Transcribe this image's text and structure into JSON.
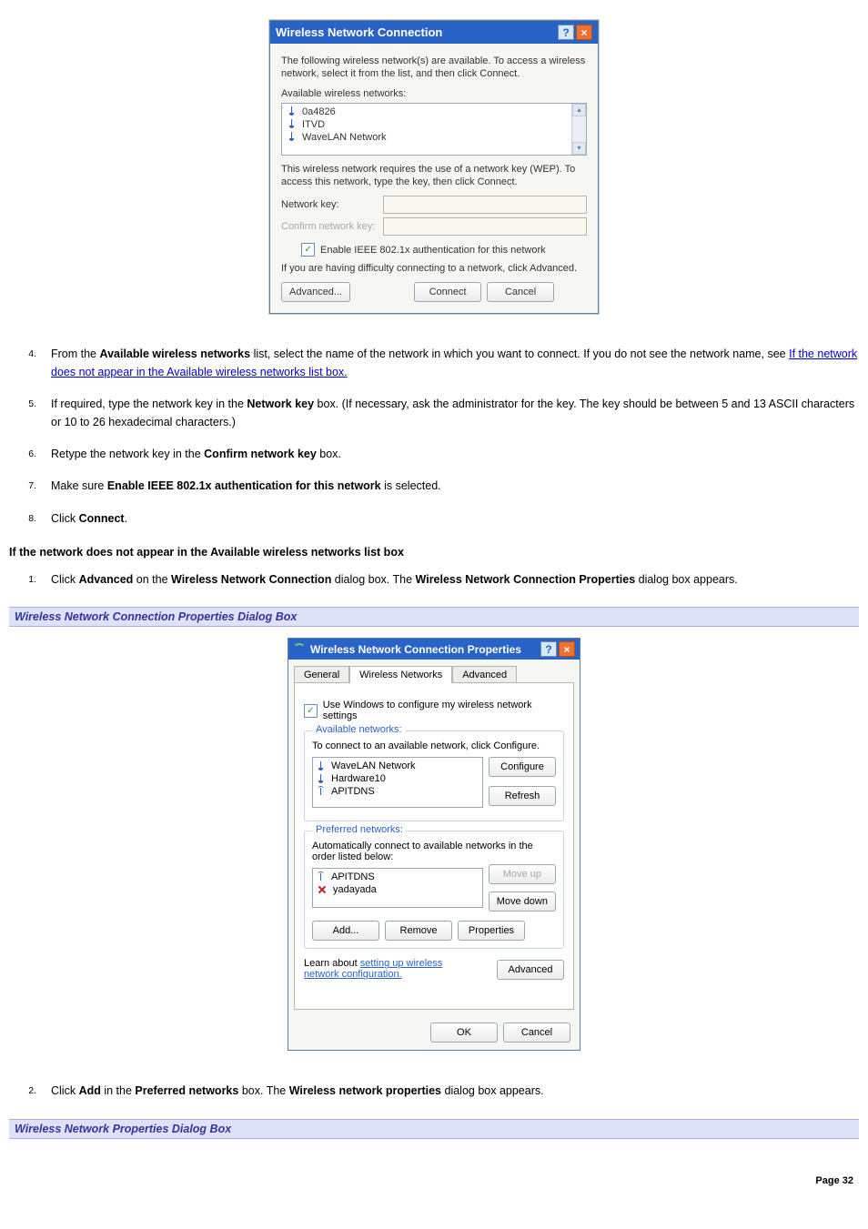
{
  "page_number": "Page 32",
  "dialog1": {
    "title": "Wireless Network Connection",
    "intro": "The following wireless network(s) are available. To access a wireless network, select it from the list, and then click Connect.",
    "available_label": "Available wireless networks:",
    "networks": [
      "0a4826",
      "ITVD",
      "WaveLAN Network"
    ],
    "wep_text": "This wireless network requires the use of a network key (WEP). To access this network, type the key, then click Connect.",
    "network_key_label": "Network key:",
    "confirm_key_label": "Confirm network key:",
    "enable_ieee_label": "Enable IEEE 802.1x authentication for this network",
    "difficulty_text": "If you are having difficulty connecting to a network, click Advanced.",
    "btn_advanced": "Advanced...",
    "btn_connect": "Connect",
    "btn_cancel": "Cancel"
  },
  "steps_a": [
    {
      "num": "4.",
      "pre": "From the ",
      "bold1": "Available wireless networks",
      "mid1": " list, select the name of the network in which you want to connect. If you do not see the network name, see ",
      "link": "If the network does not appear in the Available wireless networks list box.",
      "post": ""
    },
    {
      "num": "5.",
      "pre": "If required, type the network key in the ",
      "bold1": "Network key",
      "mid1": " box. (If necessary, ask the administrator for the key. The key should be between 5 and 13 ASCII characters or 10 to 26 hexadecimal characters.)"
    },
    {
      "num": "6.",
      "pre": "Retype the network key in the ",
      "bold1": "Confirm network key",
      "mid1": " box."
    },
    {
      "num": "7.",
      "pre": "Make sure ",
      "bold1": "Enable IEEE 802.1x authentication for this network",
      "mid1": " is selected."
    },
    {
      "num": "8.",
      "pre": "Click ",
      "bold1": "Connect",
      "mid1": "."
    }
  ],
  "heading_not_appear": "If the network does not appear in the Available wireless networks list box",
  "steps_b": [
    {
      "num": "1.",
      "pre": "Click ",
      "bold1": "Advanced",
      "mid1": " on the ",
      "bold2": "Wireless Network Connection",
      "mid2": " dialog box. The ",
      "bold3": "Wireless Network Connection Properties",
      "mid3": " dialog box appears."
    }
  ],
  "caption1": "Wireless Network Connection Properties Dialog Box",
  "dialog2": {
    "title": "Wireless Network Connection Properties",
    "tabs": {
      "general": "General",
      "wireless": "Wireless Networks",
      "advanced": "Advanced"
    },
    "chk_use_windows": "Use Windows to configure my wireless network settings",
    "group_available": "Available networks:",
    "available_hint": "To connect to an available network, click Configure.",
    "available_list": [
      "WaveLAN Network",
      "Hardware10",
      "APITDNS"
    ],
    "btn_configure": "Configure",
    "btn_refresh": "Refresh",
    "group_preferred": "Preferred networks:",
    "preferred_hint": "Automatically connect to available networks in the order listed below:",
    "preferred_list": [
      "APITDNS",
      "yadayada"
    ],
    "btn_moveup": "Move up",
    "btn_movedown": "Move down",
    "btn_add": "Add...",
    "btn_remove": "Remove",
    "btn_properties": "Properties",
    "learn_pre": "Learn about ",
    "learn_link": "setting up wireless network configuration.",
    "btn_advanced": "Advanced",
    "btn_ok": "OK",
    "btn_cancel": "Cancel"
  },
  "steps_c": [
    {
      "num": "2.",
      "pre": "Click ",
      "bold1": "Add",
      "mid1": " in the ",
      "bold2": "Preferred networks",
      "mid2": " box. The ",
      "bold3": "Wireless network properties",
      "mid3": " dialog box appears."
    }
  ],
  "caption2": "Wireless Network Properties Dialog Box"
}
